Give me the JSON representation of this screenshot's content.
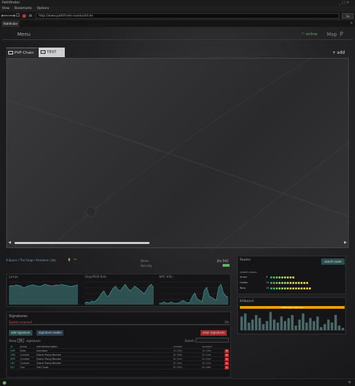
{
  "window": {
    "title": "Pathfinder",
    "controls": "_ ▢ ✕"
  },
  "menubar": {
    "items": [
      "View",
      "Bookmarks",
      "Options"
    ]
  },
  "navbar": {
    "url": "http://www.pathfinder.exodus4d.de",
    "go_label": "Go"
  },
  "browser_tab": {
    "label": "Pathfinder"
  },
  "header": {
    "menu_label": "Menu",
    "status_label": "online",
    "map_label": "Map",
    "logo_glyph": "P",
    "status_color": "#5cb85c"
  },
  "map_tabs": [
    {
      "label": "PVP Chain",
      "active": true
    },
    {
      "label": "TEST",
      "active": false
    }
  ],
  "add_label": "+ add",
  "map_scroll": {
    "position": 0.0
  },
  "system": {
    "breadcrumb": "K-Space / The Forge / Kimotoro / Jita",
    "name_label": "Name",
    "security_label": "Security",
    "class_label": "Jita [HS]",
    "security_color": "#5cb85c"
  },
  "graphs": {
    "titles": [
      "Jumps",
      "Ship/POD Kills",
      "NPC Kills"
    ],
    "line_color": "#4aa",
    "fill_color": "#3a6a6a",
    "jumps": [
      32,
      34,
      33,
      35,
      34,
      33,
      30,
      31,
      33,
      34,
      35,
      34,
      33,
      32,
      34,
      36,
      35,
      34,
      33,
      34,
      35,
      34,
      36,
      35,
      34,
      33,
      32,
      33,
      34,
      35
    ],
    "kills": [
      2,
      3,
      2,
      4,
      3,
      5,
      8,
      12,
      15,
      10,
      9,
      14,
      18,
      20,
      16,
      15,
      19,
      22,
      18,
      15,
      17,
      20,
      18,
      16,
      14,
      12,
      16,
      20,
      22,
      18
    ],
    "npc": [
      1,
      1,
      2,
      1,
      1,
      2,
      1,
      1,
      1,
      2,
      3,
      2,
      1,
      2,
      6,
      8,
      4,
      3,
      2,
      10,
      12,
      6,
      5,
      4,
      3,
      12,
      14,
      8,
      6,
      5
    ]
  },
  "signatures": {
    "title": "Signatures",
    "progress_label": "System scanned",
    "progress_pct_label": "0%",
    "progress": 0.0,
    "add_button": "add signature",
    "reader_button": "signature reader",
    "clear_button": "clear signatures",
    "show_label": "Show",
    "show_value": "10",
    "entries_label": "signatures",
    "search_label": "Search:",
    "columns": [
      "id",
      "group",
      "name/description",
      "created",
      "updated",
      ""
    ],
    "rows": [
      {
        "id": "DSP",
        "group": "Data",
        "name": "unknown",
        "created": "1h 23m",
        "updated": "1h 20m"
      },
      {
        "id": "GXK",
        "group": "Combat",
        "name": "Drone Prong Rendez",
        "created": "2h 18m",
        "updated": "2h 10m"
      },
      {
        "id": "KPR",
        "group": "Combat",
        "name": "Drone Prong Rendez",
        "created": "3h 01m",
        "updated": "2h 55m"
      },
      {
        "id": "LRC",
        "group": "Combat",
        "name": "Drone Prong Rendez",
        "created": "3h 40m",
        "updated": "3h 12m"
      },
      {
        "id": "NLT",
        "group": "Gas",
        "name": "Ore Crush",
        "created": "5h 05m",
        "updated": "4h 48m"
      }
    ]
  },
  "routes": {
    "title": "Routes",
    "search_button": "search route",
    "head": "system    jumps",
    "rows": [
      {
        "name": "Amarr",
        "count": "9",
        "dots": [
          "#2a6",
          "#4a6",
          "#6b4",
          "#8c4",
          "#9c4",
          "#ac4",
          "#bc4",
          "#cc4",
          "#cc4"
        ]
      },
      {
        "name": "Hulbar",
        "count": "14",
        "dots": [
          "#2a6",
          "#4a6",
          "#6b4",
          "#8c4",
          "#9c4",
          "#ac4",
          "#bc4",
          "#cc4",
          "#cc4",
          "#cc4",
          "#dc4",
          "#dc4",
          "#dc4",
          "#dc4"
        ]
      },
      {
        "name": "Rens",
        "count": "15",
        "dots": [
          "#2a6",
          "#4a6",
          "#6b4",
          "#8c4",
          "#9c4",
          "#ac4",
          "#bc4",
          "#cc4",
          "#cc4",
          "#cc4",
          "#dc4",
          "#dc4",
          "#dc4",
          "#dc4",
          "#dc4"
        ]
      }
    ]
  },
  "killboard": {
    "title": "Killboard",
    "banner": "1000 kills in last hour",
    "bar_color": "#4a6a6a",
    "values": [
      18,
      22,
      10,
      14,
      20,
      16,
      8,
      12,
      24,
      14,
      10,
      18,
      12,
      16,
      20,
      6,
      14,
      22,
      10,
      16,
      12,
      18,
      4,
      8,
      14,
      10,
      20,
      6,
      3
    ]
  },
  "statusbar": {
    "indicator_color": "#5cb85c",
    "right_glyph": "⚙"
  }
}
